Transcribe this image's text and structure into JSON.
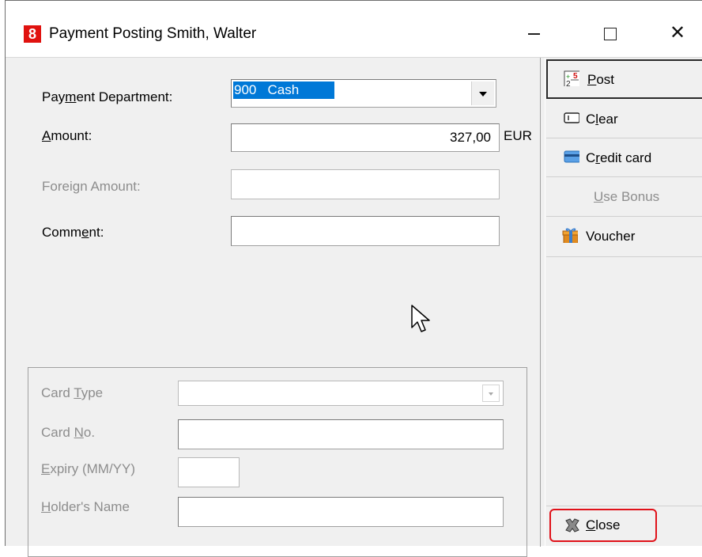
{
  "window": {
    "app_icon_text": "8",
    "title": "Payment Posting Smith, Walter",
    "minimize_label": "",
    "maximize_label": "",
    "close_glyph": "✕"
  },
  "form": {
    "payment_department": {
      "label_pre": "Pay",
      "label_ul": "m",
      "label_post": "ent Department:",
      "value": "900   Cash"
    },
    "amount": {
      "label_ul": "A",
      "label_post": "mount:",
      "value": "327,00",
      "currency": "EUR"
    },
    "foreign_amount": {
      "label_pre": "Forei",
      "label_ul": "g",
      "label_post": "n Amount:",
      "value": ""
    },
    "comment": {
      "label_pre": "Comm",
      "label_ul": "e",
      "label_post": "nt:",
      "value": ""
    }
  },
  "card": {
    "card_type": {
      "label_pre": "Card ",
      "label_ul": "T",
      "label_post": "ype",
      "value": ""
    },
    "card_no": {
      "label_pre": "Card ",
      "label_ul": "N",
      "label_post": "o.",
      "value": ""
    },
    "expiry": {
      "label_ul": "E",
      "label_post": "xpiry (MM/YY)",
      "value": ""
    },
    "holder": {
      "label_ul": "H",
      "label_post": "older's Name",
      "value": ""
    }
  },
  "sidebar": {
    "post": {
      "label_ul": "P",
      "label_post": "ost"
    },
    "clear": {
      "label_pre": "C",
      "label_ul": "l",
      "label_post": "ear"
    },
    "credit_card": {
      "label_pre": "C",
      "label_ul": "r",
      "label_post": "edit card"
    },
    "use_bonus": {
      "label_ul": "U",
      "label_post": "se Bonus"
    },
    "voucher": {
      "label": "Voucher"
    },
    "close": {
      "label_ul": "C",
      "label_post": "lose"
    }
  },
  "colors": {
    "highlight": "#0078d7",
    "app_icon": "#e0120f",
    "close_outline": "#e0121a"
  }
}
